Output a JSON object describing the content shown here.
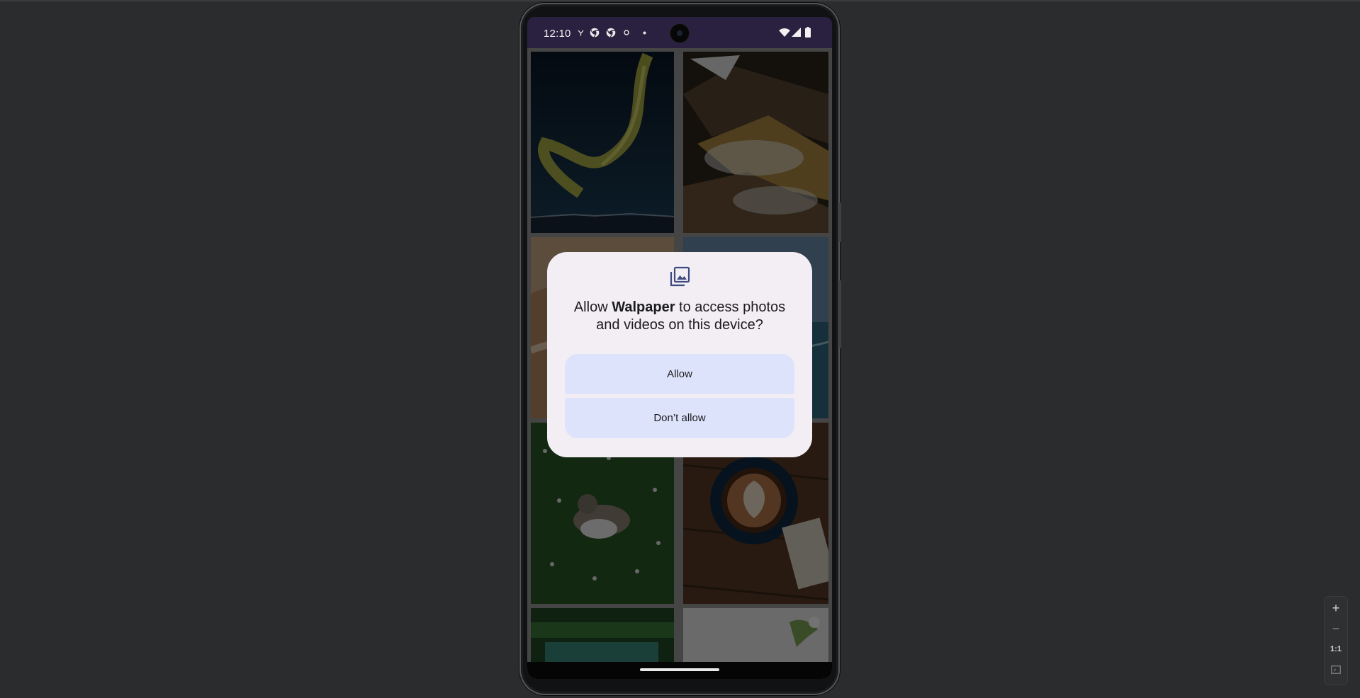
{
  "status_bar": {
    "time": "12:10",
    "left_icons": [
      "network-speed-icon",
      "chrome-icon",
      "chrome-icon",
      "sync-icon",
      "dot-icon"
    ],
    "right_icons": [
      "wifi-icon",
      "cell-signal-icon",
      "battery-icon"
    ]
  },
  "grid": {
    "tiles": [
      {
        "name": "aurora-photo",
        "colors": [
          "#0b1a2c",
          "#15324a",
          "#d8d544"
        ]
      },
      {
        "name": "volcanic-terrain-photo",
        "colors": [
          "#3a2e22",
          "#b58a42",
          "#e9e9e9"
        ]
      },
      {
        "name": "sand-dune-photo",
        "colors": [
          "#c9a27a",
          "#e8d1b2"
        ]
      },
      {
        "name": "ocean-photo",
        "colors": [
          "#5f86a8",
          "#2f6f86"
        ]
      },
      {
        "name": "cat-in-grass-photo",
        "colors": [
          "#1e4a1c",
          "#3e7a34",
          "#e8e8e8"
        ]
      },
      {
        "name": "latte-art-photo",
        "colors": [
          "#5b3b25",
          "#133148",
          "#c98b55"
        ]
      },
      {
        "name": "pool-photo",
        "colors": [
          "#214d2a",
          "#3d8d7a"
        ]
      },
      {
        "name": "plant-by-window-photo",
        "colors": [
          "#eeeeee",
          "#7da856"
        ]
      }
    ]
  },
  "dialog": {
    "icon": "photo-library-icon",
    "title_prefix": "Allow ",
    "app_name": "Walpaper",
    "title_suffix": " to access photos and videos on this device?",
    "allow_label": "Allow",
    "deny_label": "Don’t allow"
  },
  "zoom_controls": {
    "zoom_in": "+",
    "zoom_out": "−",
    "actual_size": "1:1",
    "fit_icon": "fit-screen-icon"
  },
  "colors": {
    "status_bar_bg": "#2a2140",
    "dialog_bg": "#f2eef4",
    "button_bg": "#dde3fb",
    "background": "#2b2c2e"
  }
}
